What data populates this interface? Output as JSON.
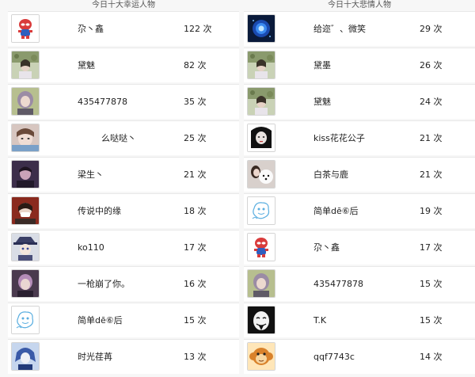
{
  "left_panel": {
    "title": "今日十大幸运人物",
    "rows": [
      {
        "name": "尕丶鑫",
        "count": "122 次",
        "avatar": "spiderman-avatar"
      },
      {
        "name": "黛魅",
        "count": "82 次",
        "avatar": "girl-flowers-avatar"
      },
      {
        "name": "435477878",
        "count": "35 次",
        "avatar": "purple-hair-avatar"
      },
      {
        "name": "么哒哒丶",
        "count": "25 次",
        "avatar": "selfie-girl-avatar"
      },
      {
        "name": "梁生丶",
        "count": "21 次",
        "avatar": "dark-portrait-avatar"
      },
      {
        "name": "传说中的缘",
        "count": "18 次",
        "avatar": "masked-girl-avatar"
      },
      {
        "name": "ko110",
        "count": "17 次",
        "avatar": "anime-hat-avatar"
      },
      {
        "name": "一枪崩了你。",
        "count": "16 次",
        "avatar": "pink-hair-avatar"
      },
      {
        "name": "简单dē⑥后",
        "count": "15 次",
        "avatar": "cartoon-sketch-avatar"
      },
      {
        "name": "时光荏苒",
        "count": "13 次",
        "avatar": "blue-anime-avatar"
      }
    ]
  },
  "right_panel": {
    "title": "今日十大悲情人物",
    "rows": [
      {
        "name": "给迩゛、微笑",
        "count": "29 次",
        "avatar": "blue-glow-avatar"
      },
      {
        "name": "黛墨",
        "count": "26 次",
        "avatar": "girl-flowers-avatar"
      },
      {
        "name": "黛魅",
        "count": "24 次",
        "avatar": "girl-flowers-avatar"
      },
      {
        "name": "kiss花花公子",
        "count": "21 次",
        "avatar": "bw-girl-avatar"
      },
      {
        "name": "白茶与鹿",
        "count": "21 次",
        "avatar": "dog-girl-avatar"
      },
      {
        "name": "简单dē⑥后",
        "count": "19 次",
        "avatar": "cartoon-sketch-avatar"
      },
      {
        "name": "尕丶鑫",
        "count": "17 次",
        "avatar": "spiderman-avatar"
      },
      {
        "name": "435477878",
        "count": "15 次",
        "avatar": "purple-hair-avatar"
      },
      {
        "name": "T.K",
        "count": "15 次",
        "avatar": "anonymous-mask-avatar"
      },
      {
        "name": "qqf7743c",
        "count": "14 次",
        "avatar": "monkey-avatar"
      }
    ]
  },
  "colors": {
    "page_bg": "#f7f7f7",
    "row_bg": "#ffffff",
    "row_border": "#e8e8e8",
    "text": "#222222"
  }
}
